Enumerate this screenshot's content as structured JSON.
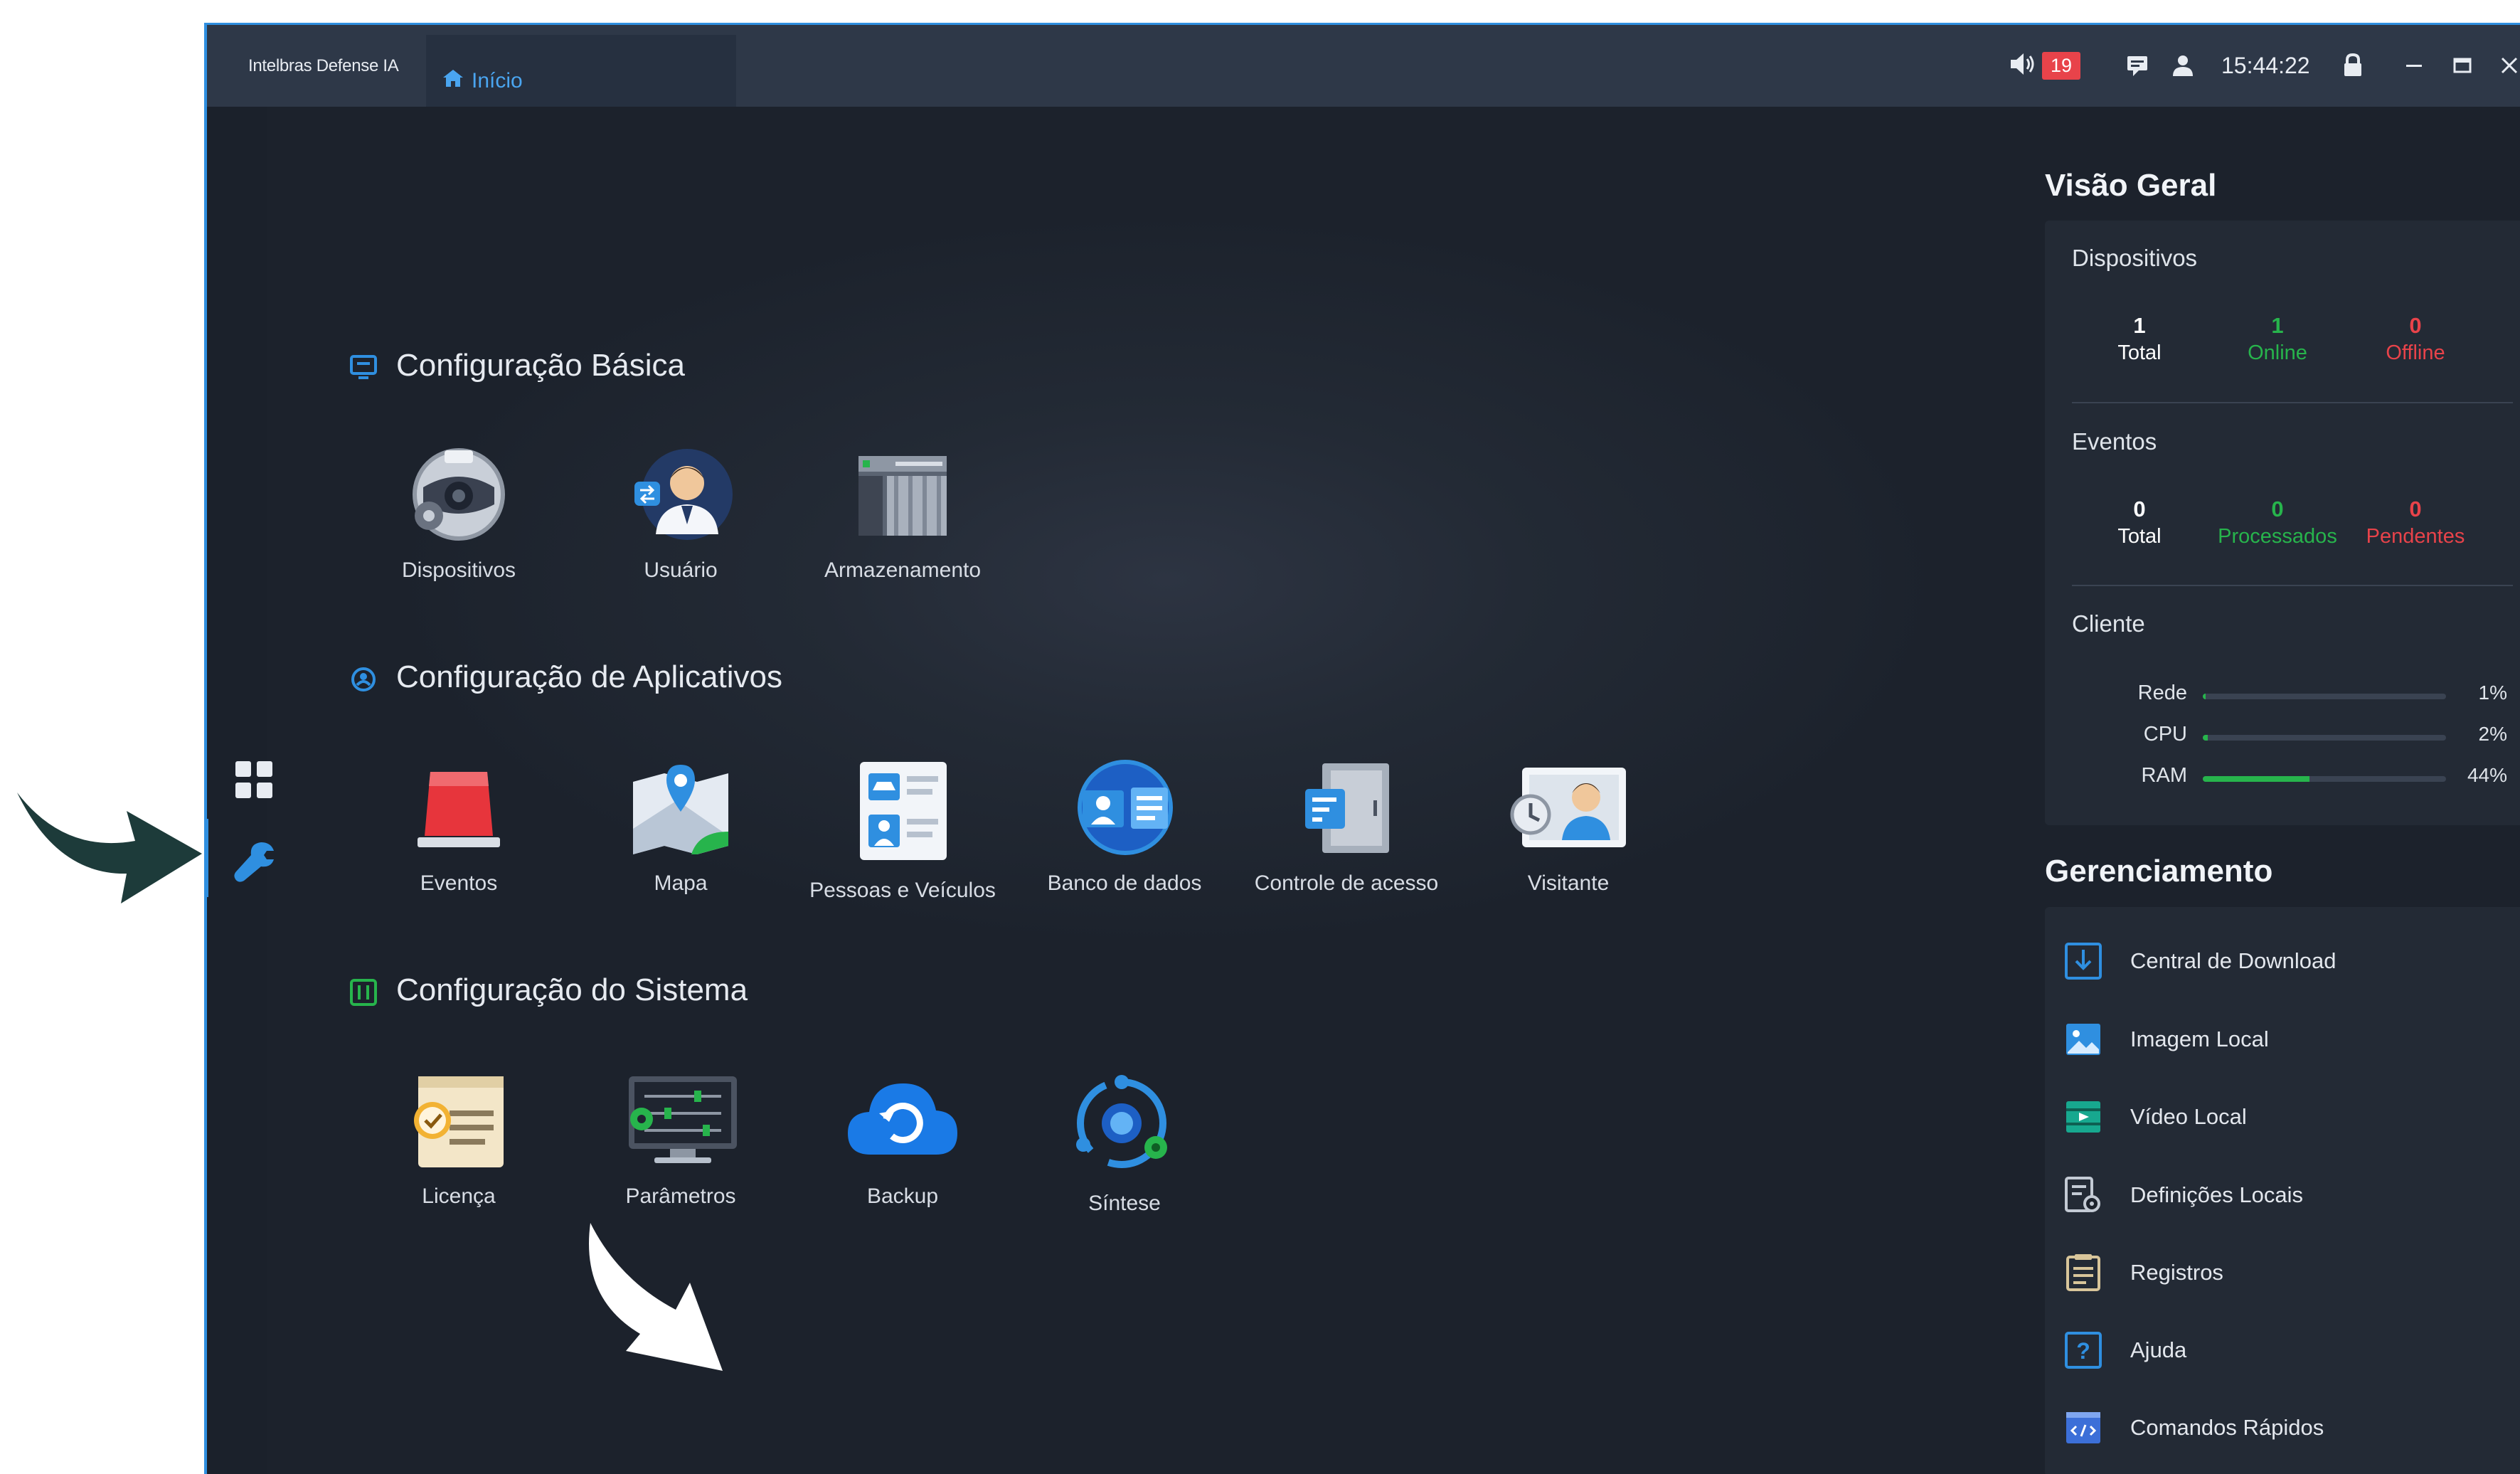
{
  "window": {
    "app_title": "Intelbras Defense IA",
    "tab_label": "Início",
    "alarm_count": "19",
    "clock": "15:44:22"
  },
  "sections": [
    {
      "title": "Configuração Básica",
      "items": [
        {
          "label": "Dispositivos",
          "icon": "device-camera-icon"
        },
        {
          "label": "Usuário",
          "icon": "user-icon"
        },
        {
          "label": "Armazenamento",
          "icon": "storage-icon"
        }
      ]
    },
    {
      "title": "Configuração de Aplicativos",
      "items": [
        {
          "label": "Eventos",
          "icon": "alarm-light-icon"
        },
        {
          "label": "Mapa",
          "icon": "map-icon"
        },
        {
          "label": "Pessoas e Veículos",
          "icon": "id-cards-icon"
        },
        {
          "label": "Banco de dados",
          "icon": "database-face-icon"
        },
        {
          "label": "Controle de acesso",
          "icon": "access-door-icon"
        },
        {
          "label": "Visitante",
          "icon": "visitor-icon"
        }
      ]
    },
    {
      "title": "Configuração do Sistema",
      "items": [
        {
          "label": "Licença",
          "icon": "license-icon"
        },
        {
          "label": "Parâmetros",
          "icon": "parameters-icon"
        },
        {
          "label": "Backup",
          "icon": "backup-cloud-icon"
        },
        {
          "label": "Síntese",
          "icon": "synthesis-icon"
        }
      ]
    }
  ],
  "overview": {
    "title": "Visão Geral",
    "devices": {
      "title": "Dispositivos",
      "total": "1",
      "total_label": "Total",
      "online": "1",
      "online_label": "Online",
      "offline": "0",
      "offline_label": "Offline"
    },
    "events": {
      "title": "Eventos",
      "total": "0",
      "total_label": "Total",
      "processed": "0",
      "processed_label": "Processados",
      "pending": "0",
      "pending_label": "Pendentes"
    },
    "client": {
      "title": "Cliente",
      "metrics": [
        {
          "label": "Rede",
          "percent": "1%",
          "value": 0.01
        },
        {
          "label": "CPU",
          "percent": "2%",
          "value": 0.02
        },
        {
          "label": "RAM",
          "percent": "44%",
          "value": 0.44
        }
      ]
    }
  },
  "management": {
    "title": "Gerenciamento",
    "items": [
      {
        "label": "Central de Download",
        "icon": "download-icon"
      },
      {
        "label": "Imagem Local",
        "icon": "image-icon"
      },
      {
        "label": "Vídeo Local",
        "icon": "video-icon"
      },
      {
        "label": "Definições Locais",
        "icon": "local-settings-icon"
      },
      {
        "label": "Registros",
        "icon": "logs-icon"
      },
      {
        "label": "Ajuda",
        "icon": "help-icon"
      },
      {
        "label": "Comandos Rápidos",
        "icon": "shortcuts-icon"
      }
    ]
  },
  "colors": {
    "accent": "#2f8fe0",
    "online": "#27b44c",
    "offline": "#e8434a",
    "badge": "#e8434a",
    "arrow": "#1d3b3a"
  }
}
